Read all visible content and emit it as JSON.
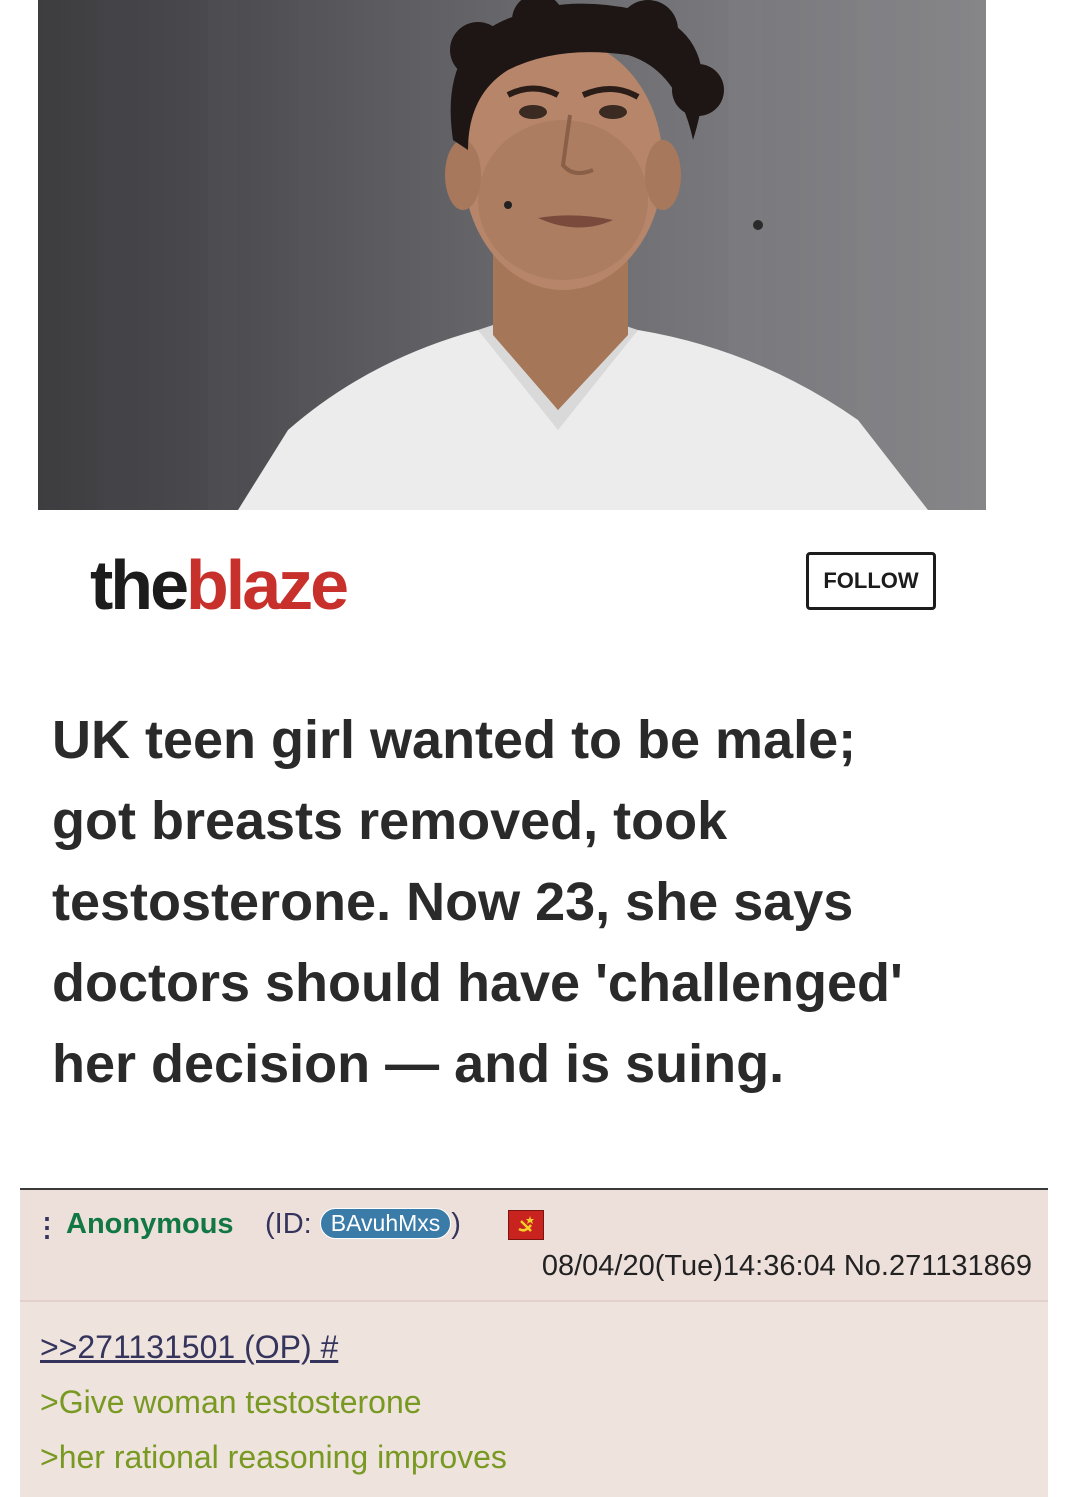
{
  "article": {
    "brand_the": "the",
    "brand_blaze": "blaze",
    "follow_label": "FOLLOW",
    "headline": "UK teen girl wanted to be male; got breasts removed, took testosterone. Now 23, she says doctors should have 'challenged' her decision — and is suing."
  },
  "post": {
    "menu_icon": "⋮",
    "name": "Anonymous",
    "id_prefix": "(ID: ",
    "id_value": "BAvuhMxs",
    "id_suffix": ")",
    "flag_icon": "soviet-flag-icon",
    "datetime": "08/04/20(Tue)14:36:04",
    "post_number": "No.271131869",
    "quote_link": ">>271131501 (OP) #",
    "greentext": [
      ">Give woman testosterone",
      ">her rational reasoning improves"
    ]
  },
  "colors": {
    "brand_red": "#c8302c",
    "name_green": "#117743",
    "greentext": "#789922",
    "link": "#34345c",
    "reply_bg": "#efe3dd",
    "id_badge": "#3b7ba8"
  }
}
